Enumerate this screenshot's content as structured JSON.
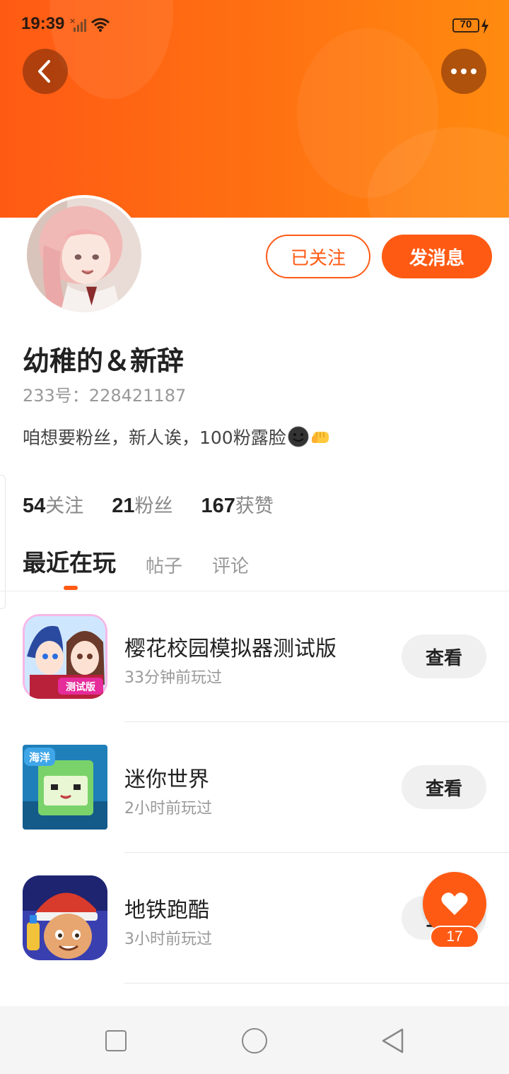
{
  "status_bar": {
    "time": "19:39",
    "battery": "70"
  },
  "profile": {
    "follow_label": "已关注",
    "message_label": "发消息",
    "username": "幼稚的＆新辞",
    "user_id": "233号：228421187",
    "bio": "咱想要粉丝，新人诶，100粉露脸"
  },
  "stats": [
    {
      "count": "54",
      "label": "关注"
    },
    {
      "count": "21",
      "label": "粉丝"
    },
    {
      "count": "167",
      "label": "获赞"
    }
  ],
  "tabs": [
    "最近在玩",
    "帖子",
    "评论"
  ],
  "games": [
    {
      "name": "樱花校园模拟器测试版",
      "time": "33分钟前玩过",
      "button": "查看"
    },
    {
      "name": "迷你世界",
      "time": "2小时前玩过",
      "button": "查看"
    },
    {
      "name": "地铁跑酷",
      "time": "3小时前玩过",
      "button": "查看"
    }
  ],
  "like": {
    "count": "17"
  },
  "colors": {
    "accent": "#ff5a14",
    "banner_end": "#ff8b10"
  }
}
